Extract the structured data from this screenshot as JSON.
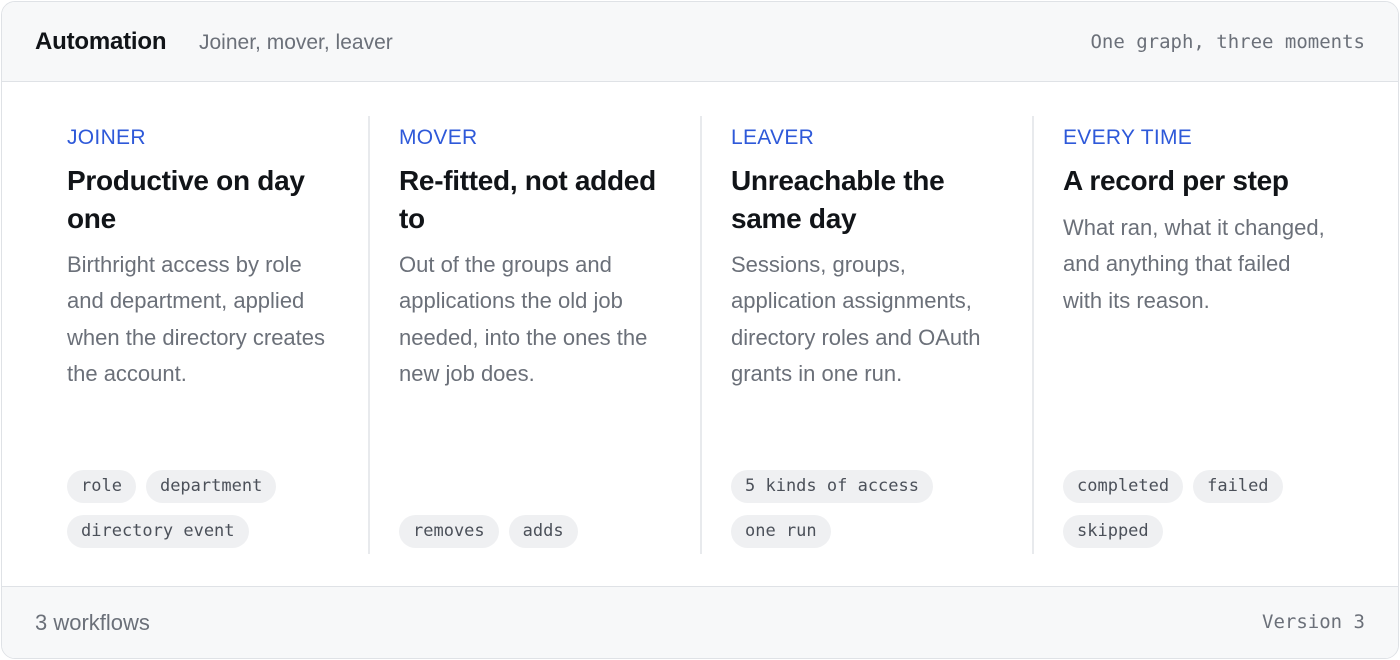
{
  "header": {
    "title": "Automation",
    "subtitle": "Joiner, mover, leaver",
    "right_label": "One graph, three moments"
  },
  "columns": [
    {
      "eyebrow": "JOINER",
      "title": "Productive on day one",
      "description": "Birthright access by role and department, applied when the directory creates the account.",
      "tags": [
        "role",
        "department",
        "directory event"
      ]
    },
    {
      "eyebrow": "MOVER",
      "title": "Re-fitted, not added to",
      "description": "Out of the groups and applications the old job needed, into the ones the new job does.",
      "tags": [
        "removes",
        "adds"
      ]
    },
    {
      "eyebrow": "LEAVER",
      "title": "Unreachable the same day",
      "description": "Sessions, groups, application assignments, directory roles and OAuth grants in one run.",
      "tags": [
        "5 kinds of access",
        "one run"
      ]
    },
    {
      "eyebrow": "EVERY TIME",
      "title": "A record per step",
      "description": "What ran, what it changed, and anything that failed with its reason.",
      "tags": [
        "completed",
        "failed",
        "skipped"
      ]
    }
  ],
  "footer": {
    "left_label": "3 workflows",
    "right_label": "Version 3"
  },
  "colors": {
    "accent": "#2e59d9",
    "border": "#dfe2e6",
    "header_bg": "#f7f8f9",
    "muted_text": "#6b7079",
    "tag_bg": "#eff0f2"
  }
}
